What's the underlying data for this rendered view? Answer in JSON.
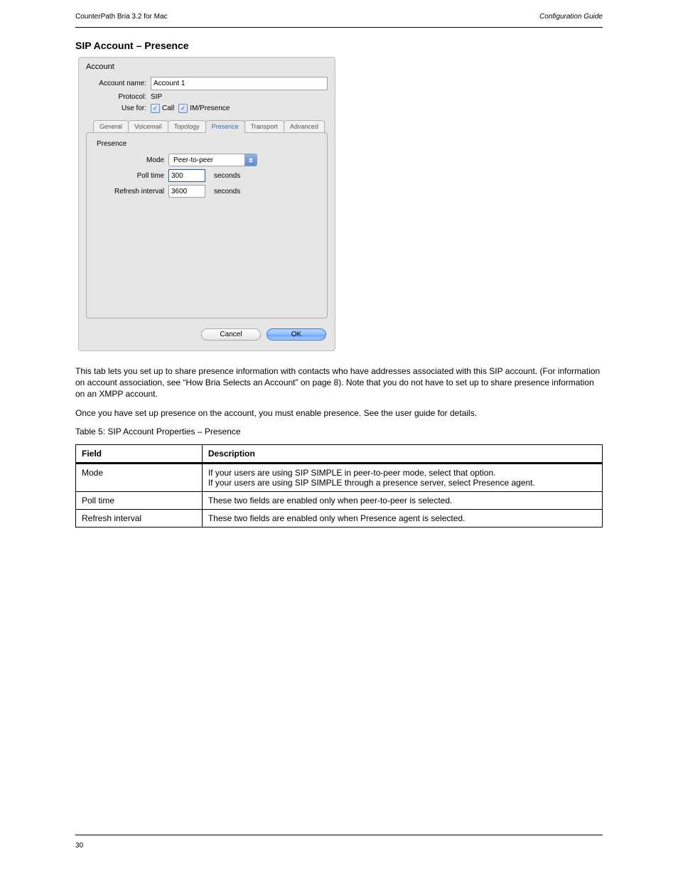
{
  "header": {
    "left": "CounterPath Bria 3.2 for Mac",
    "right": "Configuration Guide"
  },
  "section": {
    "title": "SIP Account – Presence"
  },
  "win": {
    "title": "Account",
    "account_name_label": "Account name:",
    "account_name_value": "Account 1",
    "protocol_label": "Protocol:",
    "protocol_value": "SIP",
    "use_for_label": "Use for:",
    "use_for": {
      "call": "Call",
      "im": "IM/Presence"
    },
    "tabs": [
      "General",
      "Voicemail",
      "Topology",
      "Presence",
      "Transport",
      "Advanced"
    ],
    "panel": {
      "legend": "Presence",
      "mode_label": "Mode",
      "mode_value": "Peer-to-peer",
      "poll_label": "Poll time",
      "poll_value": "300",
      "refresh_label": "Refresh interval",
      "refresh_value": "3600",
      "seconds": "seconds"
    },
    "buttons": {
      "cancel": "Cancel",
      "ok": "OK"
    }
  },
  "body": {
    "p1": "This tab lets you set up to share presence information with contacts who have addresses associated with this SIP account. (For information on account association, see “How Bria Selects an Account” on page 8). Note that you do not have to set up to share presence information on an XMPP account.",
    "p2a": "Once you have set up presence on the account, you must enable presence. ",
    "p2b": "See the user guide for details."
  },
  "table": {
    "header_label": "Table 5: SIP Account Properties – Presence",
    "cols": [
      "Field",
      "Description"
    ],
    "rows": [
      {
        "field": "Mode",
        "desc_line1": "If your users are using SIP SIMPLE in peer-to-peer mode, select that option.",
        "desc_line2": "If your users are using SIP SIMPLE through a presence server, select Presence agent."
      },
      {
        "field": "Poll time",
        "desc": "These two fields are enabled only when peer-to-peer is selected."
      },
      {
        "field": "Refresh interval",
        "desc": "These two fields are enabled only when Presence agent is selected."
      }
    ]
  },
  "footer": {
    "page": "30"
  }
}
